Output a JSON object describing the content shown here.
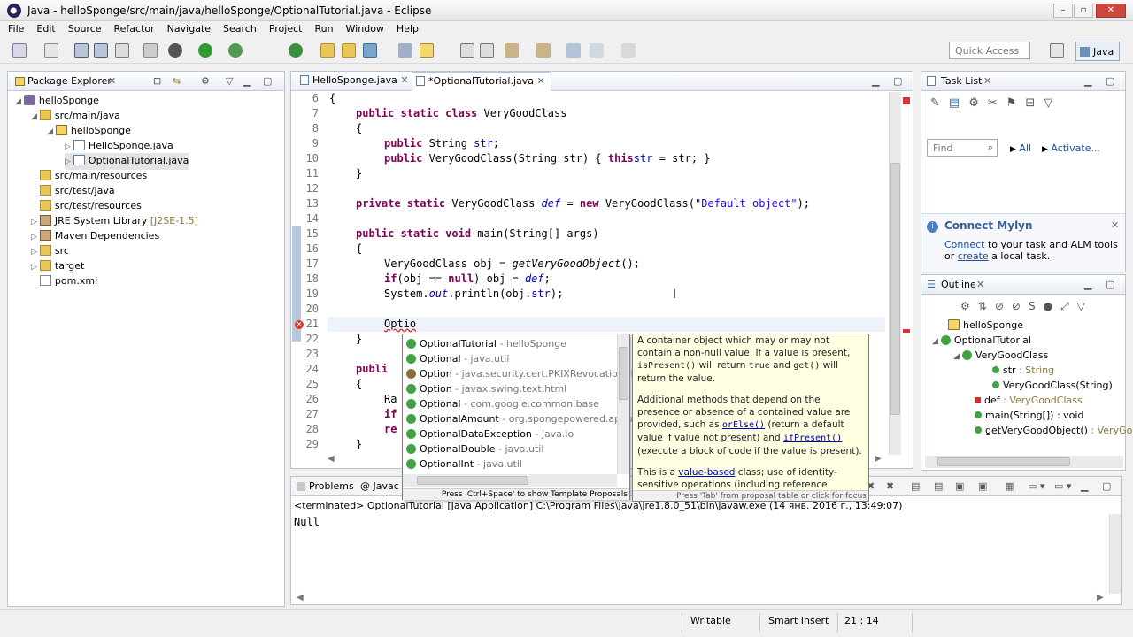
{
  "window": {
    "title": "Java - helloSponge/src/main/java/helloSponge/OptionalTutorial.java - Eclipse"
  },
  "menu": [
    "File",
    "Edit",
    "Source",
    "Refactor",
    "Navigate",
    "Search",
    "Project",
    "Run",
    "Window",
    "Help"
  ],
  "toolbar": {
    "quick_access": "Quick Access",
    "perspective": "Java"
  },
  "package_explorer": {
    "title": "Package Explorer",
    "items": [
      {
        "label": "helloSponge",
        "extra": ""
      },
      {
        "label": "src/main/java",
        "extra": ""
      },
      {
        "label": "helloSponge",
        "extra": ""
      },
      {
        "label": "HelloSponge.java",
        "extra": ""
      },
      {
        "label": "OptionalTutorial.java",
        "extra": ""
      },
      {
        "label": "src/main/resources",
        "extra": ""
      },
      {
        "label": "src/test/java",
        "extra": ""
      },
      {
        "label": "src/test/resources",
        "extra": ""
      },
      {
        "label": "JRE System Library",
        "extra": "[J2SE-1.5]"
      },
      {
        "label": "Maven Dependencies",
        "extra": ""
      },
      {
        "label": "src",
        "extra": ""
      },
      {
        "label": "target",
        "extra": ""
      },
      {
        "label": "pom.xml",
        "extra": ""
      }
    ]
  },
  "editor": {
    "tabs": [
      {
        "label": "HelloSponge.java"
      },
      {
        "label": "*OptionalTutorial.java"
      }
    ],
    "line_numbers": [
      "6",
      "7",
      "8",
      "9",
      "10",
      "11",
      "12",
      "13",
      "14",
      "15",
      "16",
      "17",
      "18",
      "19",
      "20",
      "21",
      "22",
      "23",
      "24",
      "25",
      "26",
      "27",
      "28",
      "29"
    ],
    "lines": {
      "l6": "{",
      "l7a": "public static class",
      "l7b": " VeryGoodClass",
      "l8": "{",
      "l9a": "public",
      "l9b": " String ",
      "l9c": "str",
      ";": ";",
      "l10a": "public",
      "l10b": " VeryGoodClass(String str) { ",
      "l10c": "this",
      ".": ".",
      "l10d": "str",
      "l10e": " = str; }",
      "l11": "}",
      "l13a": "private static",
      "l13b": " VeryGoodClass ",
      "l13c": "def",
      "l13d": " = ",
      "l13e": "new",
      "l13f": " VeryGoodClass(",
      "l13g": "\"Default object\"",
      "l13h": ");",
      "l15a": "public static void",
      "l15b": " main(String[] args)",
      "l16": "{",
      "l17a": "VeryGoodClass obj = ",
      "l17b": "getVeryGoodObject",
      "l17c": "();",
      "l18a": "if",
      "l18b": "(obj == ",
      "l18c": "null",
      "l18d": ") obj = ",
      "l18e": "def",
      "l18f": ";",
      "l19a": "System.",
      "l19b": "out",
      "l19c": ".println(obj.",
      "l19d": "str",
      "l19e": ");",
      "l21": "Optio",
      "l22": "}",
      "l24": "publi",
      "l25": "{",
      "l26": "Ra",
      "l27": "if",
      "l28": "re",
      "l29": "}"
    }
  },
  "content_assist": {
    "items": [
      {
        "name": "OptionalTutorial",
        "qual": " - helloSponge"
      },
      {
        "name": "Optional",
        "qual": " - java.util"
      },
      {
        "name": "Option",
        "qual": " - java.security.cert.PKIXRevocationCh"
      },
      {
        "name": "Option",
        "qual": " - javax.swing.text.html"
      },
      {
        "name": "Optional",
        "qual": " - com.google.common.base"
      },
      {
        "name": "OptionalAmount",
        "qual": " - org.spongepowered.api.util"
      },
      {
        "name": "OptionalDataException",
        "qual": " - java.io"
      },
      {
        "name": "OptionalDouble",
        "qual": " - java.util"
      },
      {
        "name": "OptionalInt",
        "qual": " - java.util"
      }
    ],
    "footer": "Press 'Ctrl+Space' to show Template Proposals"
  },
  "javadoc": {
    "p1a": "A container object which may or may not contain a non-null value. If a value is present, ",
    "p1b": "isPresent()",
    "p1c": " will return ",
    "p1d": "true",
    "p1e": " and ",
    "p1f": "get()",
    "p1g": " will return the value.",
    "p2a": "Additional methods that depend on the presence or absence of a contained value are provided, such as ",
    "p2b": "orElse()",
    "p2c": " (return a default value if value not present) and ",
    "p2d": "ifPresent()",
    "p2e": " (execute a block of code if the value is present).",
    "p3a": "This is a ",
    "p3b": "value-based",
    "p3c": " class; use of identity-sensitive operations (including reference equality (==), identity hash code, or synchronization) on instances of",
    "footer": "Press 'Tab' from proposal table or click for focus"
  },
  "task_list": {
    "title": "Task List",
    "find_placeholder": "Find",
    "all": "All",
    "activate": "Activate..."
  },
  "mylyn": {
    "title": "Connect Mylyn",
    "connect": "Connect",
    "text1": " to your task and ALM tools or ",
    "create": "create",
    "text2": " a local task."
  },
  "outline": {
    "title": "Outline",
    "items": [
      {
        "label": "helloSponge",
        "type": ""
      },
      {
        "label": "OptionalTutorial",
        "type": ""
      },
      {
        "label": "VeryGoodClass",
        "type": ""
      },
      {
        "label": "str",
        "type": " : String"
      },
      {
        "label": "VeryGoodClass(String)",
        "type": ""
      },
      {
        "label": "def",
        "type": " : VeryGoodClass"
      },
      {
        "label": "main(String[]) : void",
        "type": ""
      },
      {
        "label": "getVeryGoodObject()",
        "type": " : VeryGo"
      }
    ]
  },
  "console": {
    "tabs": [
      "Problems",
      "@ Javac"
    ],
    "header": "<terminated> OptionalTutorial [Java Application] C:\\Program Files\\Java\\jre1.8.0_51\\bin\\javaw.exe (14 янв. 2016 г., 13:49:07)",
    "output": "Null"
  },
  "status": {
    "writable": "Writable",
    "insert": "Smart Insert",
    "position": "21 : 14"
  }
}
